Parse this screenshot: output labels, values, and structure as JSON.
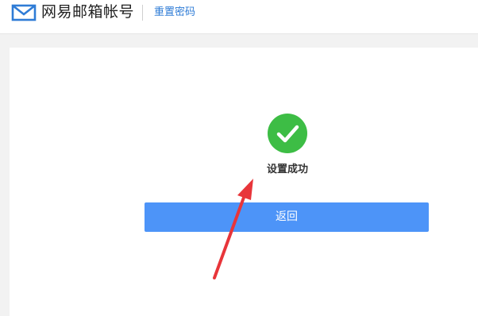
{
  "header": {
    "logo_icon": "mail-envelope-icon",
    "brand_title": "网易邮箱帐号",
    "link_label": "重置密码"
  },
  "main": {
    "status_icon": "success-check-icon",
    "status_text": "设置成功",
    "back_label": "返回"
  },
  "colors": {
    "brand_blue": "#2f7cd6",
    "success_green": "#3dbd45",
    "button_blue": "#4d94f8",
    "annotation_red": "#e8353a"
  }
}
